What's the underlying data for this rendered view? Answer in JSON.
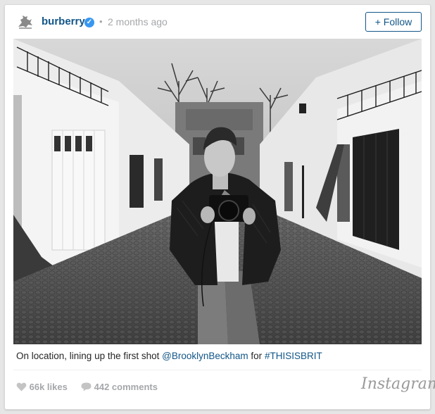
{
  "post": {
    "username": "burberry",
    "separator": "•",
    "time": "2 months ago",
    "follow_label": "+ Follow",
    "caption": {
      "text": "On location, lining up the first shot",
      "mention": "@BrooklynBeckham",
      "connector": "for",
      "hashtag": "#THISISBRIT"
    },
    "likes": "66k likes",
    "comments": "442 comments",
    "brand": "Instagram"
  },
  "icons": {
    "avatar": "burberry-knight-logo-icon",
    "verified": "verified-badge-icon",
    "heart": "heart-icon",
    "comment": "comment-bubble-icon"
  },
  "colors": {
    "link": "#125688",
    "muted": "#a5a7aa",
    "verified": "#3897f0"
  }
}
